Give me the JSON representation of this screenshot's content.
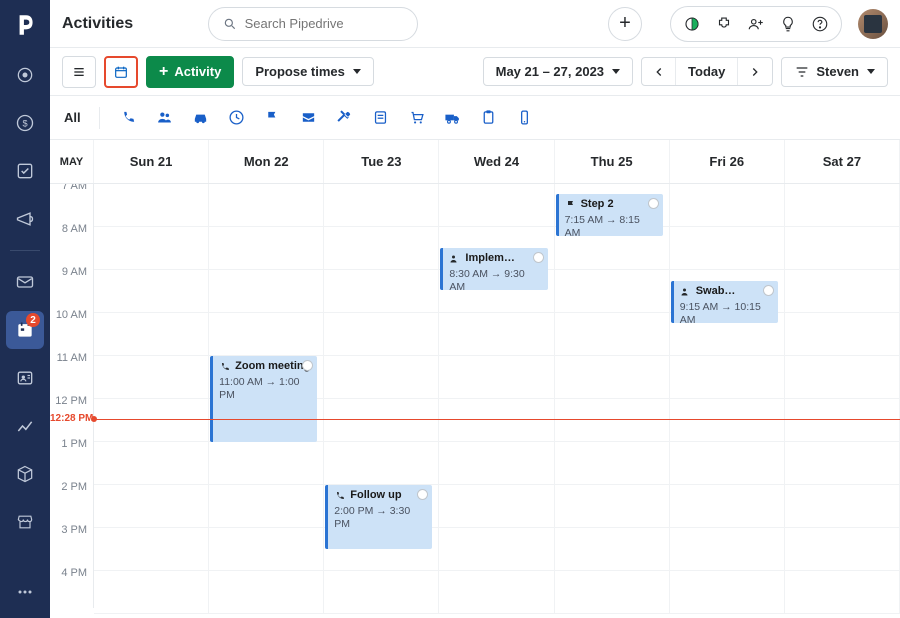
{
  "sidebar": {
    "badge_count": "2"
  },
  "header": {
    "title": "Activities",
    "search_placeholder": "Search Pipedrive"
  },
  "toolbar": {
    "activity_label": "Activity",
    "propose_label": "Propose times",
    "date_range": "May 21 – 27, 2023",
    "today_label": "Today",
    "filter_user": "Steven"
  },
  "filters": {
    "all_label": "All"
  },
  "days": {
    "gutter": "MAY",
    "d0": "Sun 21",
    "d1": "Mon 22",
    "d2": "Tue 23",
    "d3": "Wed 24",
    "d4": "Thu 25",
    "d5": "Fri 26",
    "d6": "Sat 27"
  },
  "times": {
    "t0": "7 AM",
    "t1": "8 AM",
    "t2": "9 AM",
    "t3": "10 AM",
    "t4": "11 AM",
    "t5": "12 PM",
    "t6": "1 PM",
    "t7": "2 PM",
    "t8": "3 PM",
    "t9": "4 PM"
  },
  "now": {
    "label": "12:28 PM"
  },
  "events": {
    "zoom": {
      "title": "Zoom meeting",
      "time": "11:00 AM → 1:00 PM"
    },
    "followup": {
      "title": "Follow up",
      "time": "2:00 PM → 3:30 PM"
    },
    "implem": {
      "title": "Implem…",
      "time": "8:30 AM → 9:30 AM"
    },
    "step2": {
      "title": "Step 2",
      "time": "7:15 AM → 8:15 AM"
    },
    "swab": {
      "title": "Swab…",
      "time": "9:15 AM → 10:15 AM"
    }
  }
}
